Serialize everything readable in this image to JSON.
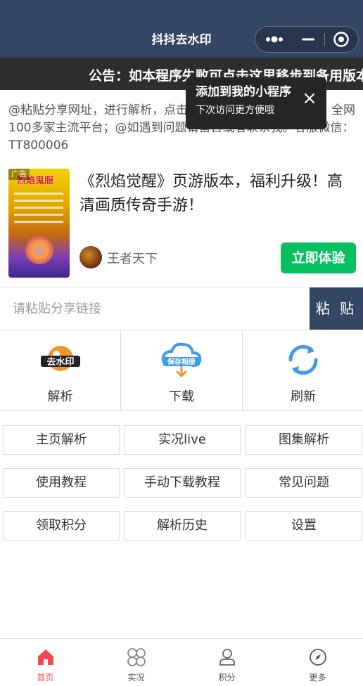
{
  "navbar": {
    "title": "抖抖去水印",
    "capsule": {
      "more_icon": "more-dots-icon",
      "minimize_icon": "minimize-icon",
      "close_icon": "target-circle-icon"
    }
  },
  "notice": {
    "text": "公告：如本程序失败可点击这里移步到备用版本"
  },
  "description": "@粘贴分享网址，进行解析，点击保存到相册即可。@支持：全网100多家主流平台；@如遇到问题请留言或者联系我。客服微信：TT800006",
  "tooltip": {
    "title": "添加到我的小程序",
    "subtitle": "下次访问更方便哦",
    "close_icon": "close-icon"
  },
  "ad": {
    "badge": "广告",
    "image_title": "烈焰鬼服",
    "headline": "《烈焰觉醒》页游版本，福利升级！高清画质传奇手游！",
    "brand": "王者天下",
    "cta": "立即体验",
    "cta_color": "#07c160"
  },
  "paste": {
    "placeholder": "请粘贴分享链接",
    "button": "粘 贴"
  },
  "actions": [
    {
      "label": "解析",
      "icon": "watermark-remove-icon"
    },
    {
      "label": "下载",
      "icon": "cloud-download-icon"
    },
    {
      "label": "刷新",
      "icon": "refresh-icon"
    }
  ],
  "links": [
    {
      "label": "主页解析"
    },
    {
      "label": "实况live"
    },
    {
      "label": "图集解析"
    },
    {
      "label": "使用教程"
    },
    {
      "label": "手动下载教程"
    },
    {
      "label": "常见问题"
    },
    {
      "label": "领取积分"
    },
    {
      "label": "解析历史"
    },
    {
      "label": "设置"
    }
  ],
  "tabbar": [
    {
      "label": "首页",
      "icon": "home-icon",
      "active": true
    },
    {
      "label": "实况",
      "icon": "four-petal-icon",
      "active": false
    },
    {
      "label": "积分",
      "icon": "user-icon",
      "active": false
    },
    {
      "label": "更多",
      "icon": "compass-icon",
      "active": false
    }
  ],
  "colors": {
    "primary": "#344866",
    "accent": "#f2494b",
    "notice_bg": "#2e2e2e",
    "icon_blue": "#3f9ae8",
    "icon_orange": "#f0962e"
  }
}
